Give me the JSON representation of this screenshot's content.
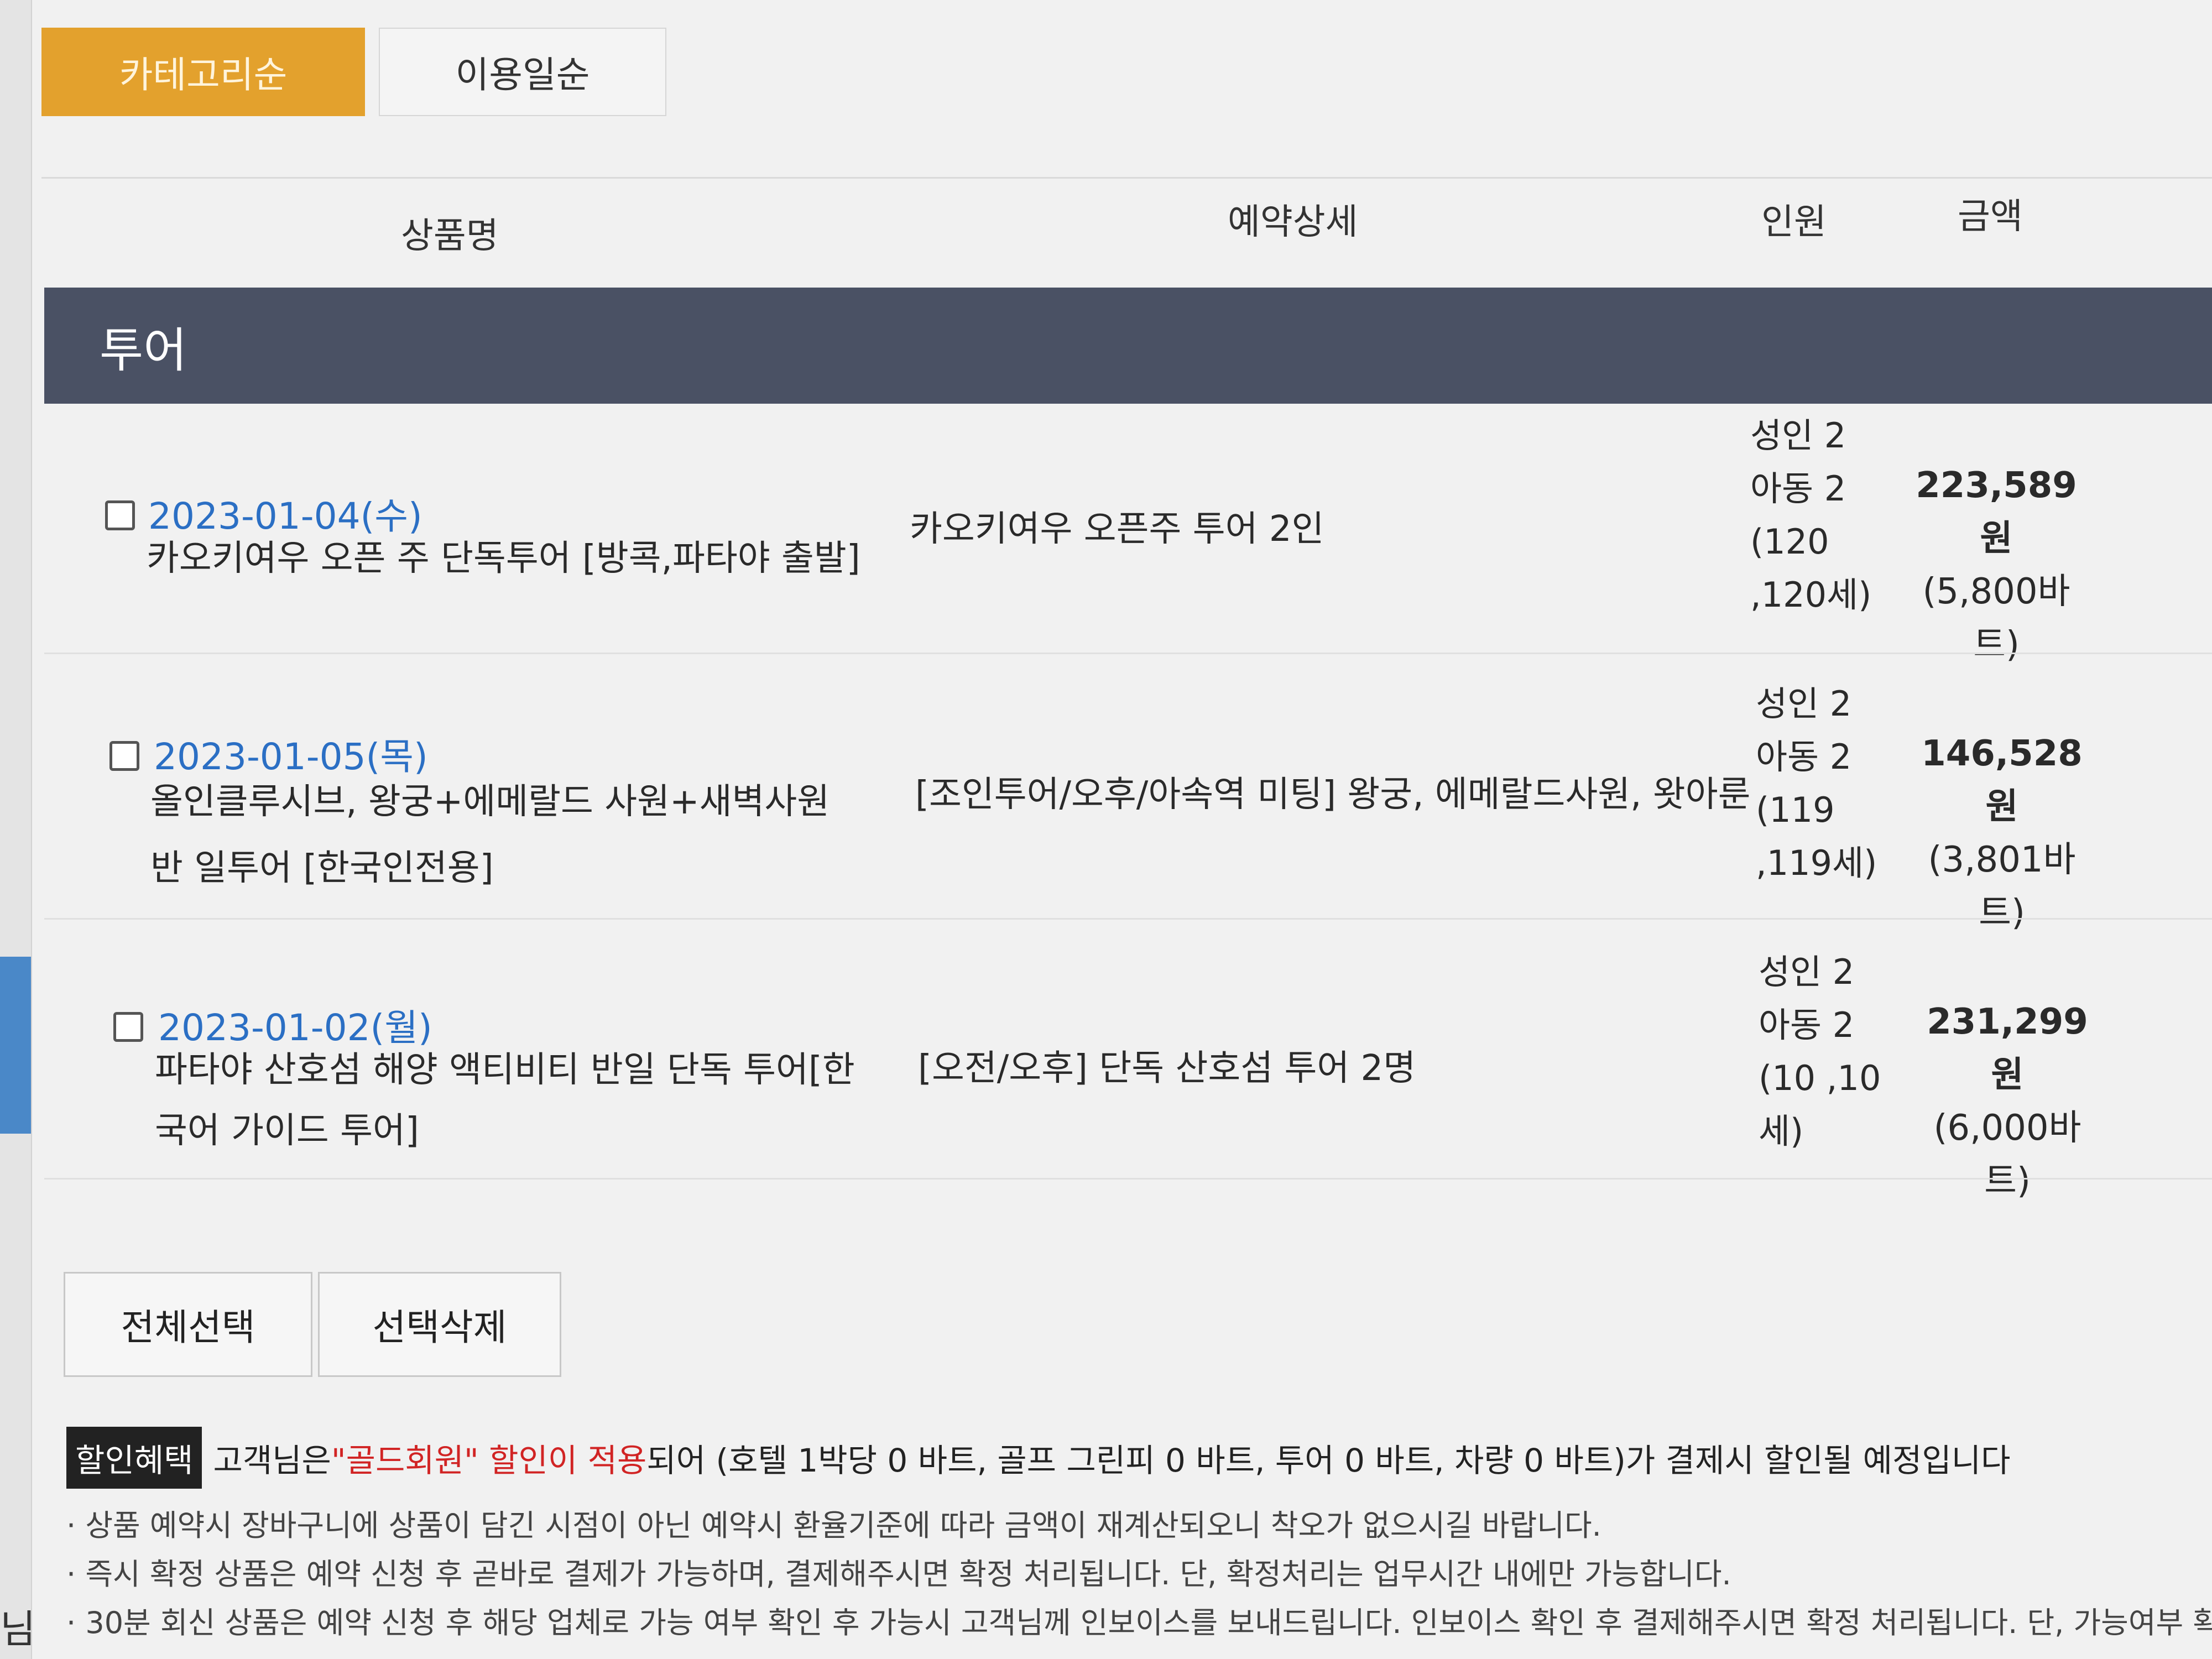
{
  "tabs": {
    "category": "카테고리순",
    "usedate": "이용일순"
  },
  "columns": {
    "product": "상품명",
    "detail": "예약상세",
    "people": "인원",
    "amount": "금액"
  },
  "section": {
    "title": "투어"
  },
  "rows": [
    {
      "date": "2023-01-04(수)",
      "name": "카오키여우 오픈 주 단독투어 [방콕,파타야 출발]",
      "detail": "카오키여우 오픈주 투어 2인",
      "people": [
        "성인 2",
        "아동 2",
        "(120",
        ",120세)"
      ],
      "price": "223,589원",
      "price_baht": "(5,800바트)"
    },
    {
      "date": "2023-01-05(목)",
      "name": "올인클루시브, 왕궁+에메랄드 사원+새벽사원 반 일투어 [한국인전용]",
      "detail": "[조인투어/오후/아속역 미팅] 왕궁, 에메랄드사원, 왓아룬",
      "people": [
        "성인 2",
        "아동 2",
        "(119",
        ",119세)"
      ],
      "price": "146,528원",
      "price_baht": "(3,801바트)"
    },
    {
      "date": "2023-01-02(월)",
      "name": "파타야 산호섬 해양 액티비티 반일 단독 투어[한국어 가이드 투어]",
      "detail": "[오전/오후] 단독 산호섬 투어 2명",
      "people": [
        "성인 2",
        "아동 2",
        "(10 ,10",
        "세)"
      ],
      "price": "231,299원",
      "price_baht": "(6,000바트)"
    }
  ],
  "buttons": {
    "select_all": "전체선택",
    "delete_selected": "선택삭제"
  },
  "discount": {
    "badge": "할인혜택",
    "prefix": "고객님은 ",
    "highlight": "\"골드회원\" 할인이 적용",
    "suffix": "되어 (호텔 1박당 0 바트, 골프 그린피 0 바트, 투어 0 바트, 차량 0 바트)가 결제시 할인될 예정입니다"
  },
  "notes": [
    "상품 예약시 장바구니에 상품이 담긴 시점이 아닌 예약시 환율기준에 따라 금액이 재계산되오니 착오가 없으시길 바랍니다.",
    "즉시 확정 상품은 예약 신청 후 곧바로 결제가 가능하며, 결제해주시면 확정 처리됩니다. 단, 확정처리는 업무시간 내에만 가능합니다.",
    "30분 회신 상품은 예약 신청 후 해당 업체로 가능 여부 확인 후 가능시 고객님께 인보이스를 보내드립니다. 인보이스 확인 후 결제해주시면 확정 처리됩니다. 단, 가능여부 확"
  ],
  "edge_char": "님",
  "colors": {
    "active_tab": "#e3a12d",
    "section_bar": "#4a5164",
    "date_link": "#2b6fc4",
    "highlight_red": "#d12424"
  }
}
